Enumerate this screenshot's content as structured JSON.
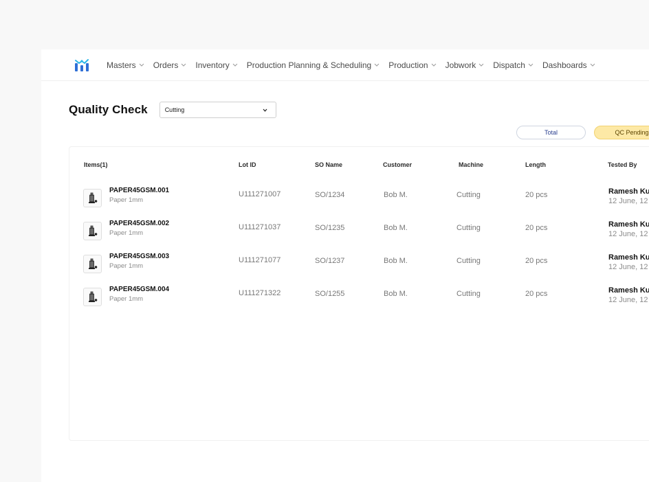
{
  "nav": {
    "items": [
      {
        "label": "Masters"
      },
      {
        "label": "Orders"
      },
      {
        "label": "Inventory"
      },
      {
        "label": "Production Planning & Scheduling"
      },
      {
        "label": "Production"
      },
      {
        "label": "Jobwork"
      },
      {
        "label": "Dispatch"
      },
      {
        "label": "Dashboards"
      }
    ]
  },
  "header": {
    "title": "Quality Check",
    "stage_select": {
      "value": "Cutting"
    }
  },
  "filters": {
    "total_label": "Total",
    "pending_label": "QC Pending"
  },
  "table": {
    "headers": {
      "items": "Items(1)",
      "lot_id": "Lot ID",
      "so_name": "SO Name",
      "customer": "Customer",
      "machine": "Machine",
      "length": "Length",
      "tested_by": "Tested By"
    },
    "rows": [
      {
        "code": "PAPER45GSM.001",
        "sub": "Paper 1mm",
        "lot": "U111271007",
        "so": "SO/1234",
        "customer": "Bob M.",
        "machine": "Cutting",
        "length": "20 pcs",
        "tested_by": "Ramesh Ku",
        "tested_at": "12 June, 12"
      },
      {
        "code": "PAPER45GSM.002",
        "sub": "Paper 1mm",
        "lot": "U111271037",
        "so": "SO/1235",
        "customer": "Bob M.",
        "machine": "Cutting",
        "length": "20 pcs",
        "tested_by": "Ramesh Ku",
        "tested_at": "12 June, 12"
      },
      {
        "code": "PAPER45GSM.003",
        "sub": "Paper 1mm",
        "lot": "U111271077",
        "so": "SO/1237",
        "customer": "Bob M.",
        "machine": "Cutting",
        "length": "20 pcs",
        "tested_by": "Ramesh Ku",
        "tested_at": "12 June, 12"
      },
      {
        "code": "PAPER45GSM.004",
        "sub": "Paper 1mm",
        "lot": "U111271322",
        "so": "SO/1255",
        "customer": "Bob M.",
        "machine": "Cutting",
        "length": "20 pcs",
        "tested_by": "Ramesh Ku",
        "tested_at": "12 June, 12"
      }
    ]
  },
  "icons": {
    "logo": "brand-logo-icon",
    "chevron": "chevron-down-icon",
    "thumb": "bobbin-icon"
  },
  "colors": {
    "brand_blue": "#2f6fd6",
    "brand_cyan": "#29b6e8",
    "pending_bg": "#fde9a6",
    "total_text": "#2a3f8f"
  }
}
